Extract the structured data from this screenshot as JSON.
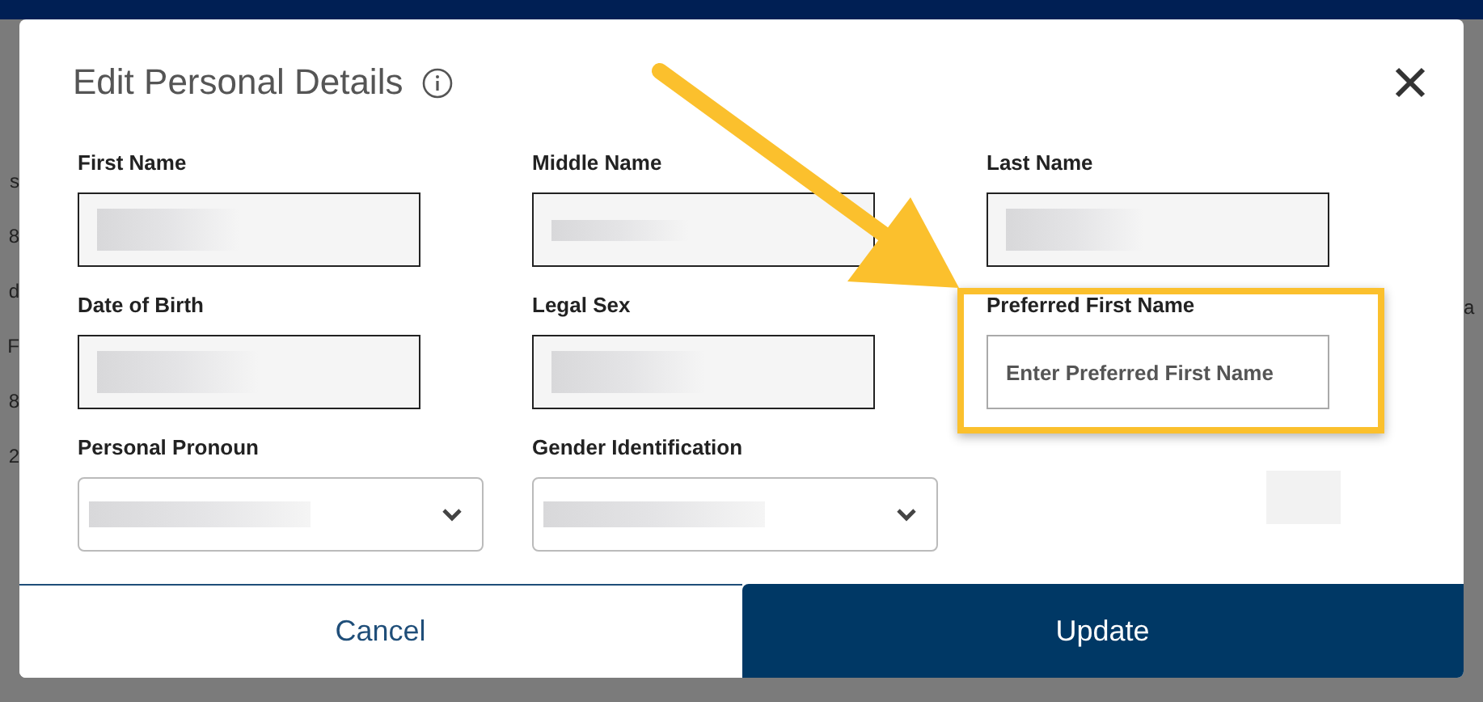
{
  "background": {
    "left_fragments": [
      "s",
      "8",
      "d",
      "F",
      "8",
      "2"
    ],
    "right_fragments": [
      "a"
    ]
  },
  "dialog": {
    "title": "Edit Personal Details",
    "fields": [
      {
        "kind": "text",
        "label": "First Name",
        "readonly": true,
        "redacted": true
      },
      {
        "kind": "text",
        "label": "Middle Name",
        "readonly": true,
        "redacted": true
      },
      {
        "kind": "text",
        "label": "Last Name",
        "readonly": true,
        "redacted": true
      },
      {
        "kind": "text",
        "label": "Date of Birth",
        "readonly": true,
        "redacted": true
      },
      {
        "kind": "text",
        "label": "Legal Sex",
        "readonly": true,
        "redacted": true
      },
      {
        "kind": "text",
        "label": "Preferred First Name",
        "readonly": false,
        "placeholder": "Enter Preferred First Name",
        "highlighted": true
      },
      {
        "kind": "select",
        "label": "Personal Pronoun",
        "redacted": true
      },
      {
        "kind": "select",
        "label": "Gender Identification",
        "redacted": true
      },
      {
        "kind": "blank",
        "redacted": true
      }
    ],
    "buttons": [
      {
        "kind": "secondary",
        "label": "Cancel"
      },
      {
        "kind": "primary",
        "label": "Update"
      }
    ]
  }
}
